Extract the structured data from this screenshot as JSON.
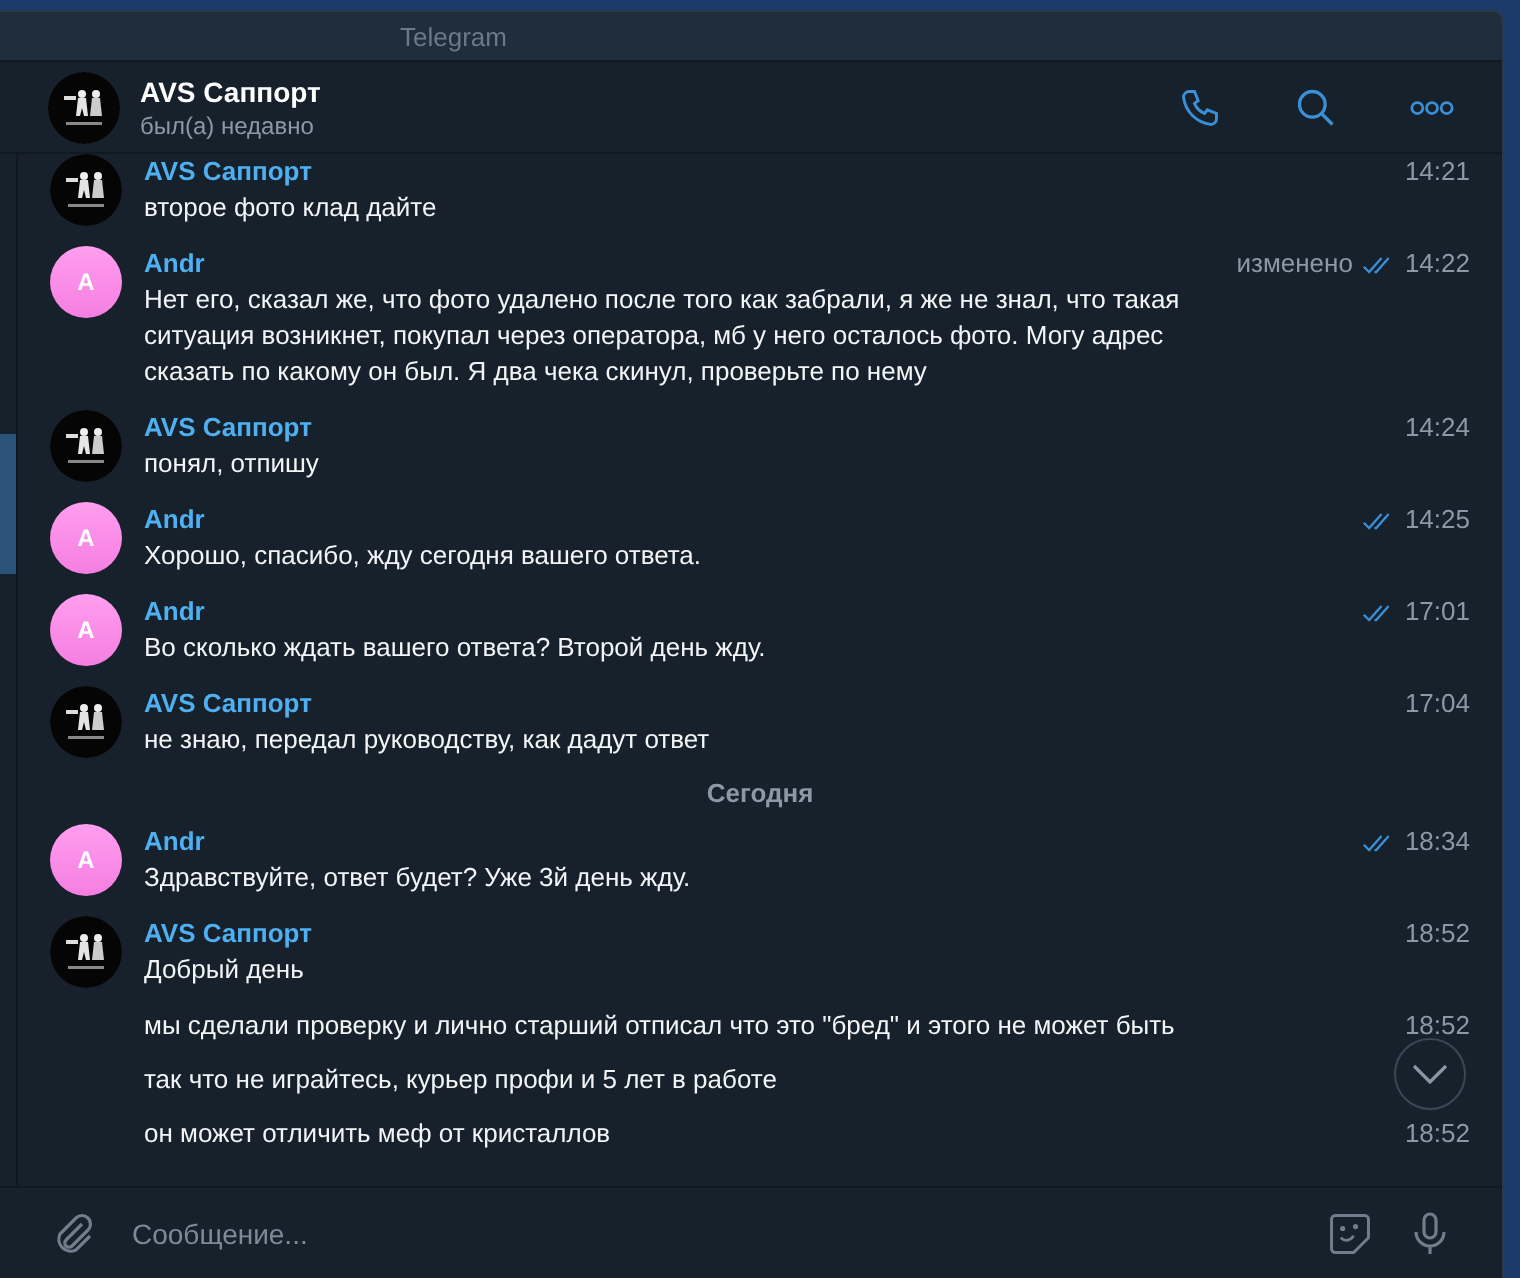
{
  "window": {
    "title": "Telegram"
  },
  "chat": {
    "name": "AVS Саппорт",
    "status": "был(а) недавно"
  },
  "messages": [
    {
      "kind": "message",
      "sender": "AVS Саппорт",
      "text": "второе фото клад дайте",
      "time": "14:21"
    },
    {
      "kind": "message",
      "sender": "Andr",
      "avatar": {
        "kind": "letter",
        "letter": "A"
      },
      "text": "Нет его, сказал же, что фото удалено после того как забрали, я же не знал, что такая ситуация возникнет, покупал через оператора, мб у него осталось фото. Могу адрес сказать по какому он был. Я два чека скинул, проверьте по нему",
      "time": "14:22",
      "edited": "изменено",
      "read": true
    },
    {
      "kind": "message",
      "sender": "AVS Саппорт",
      "text": "понял, отпишу",
      "time": "14:24"
    },
    {
      "kind": "message",
      "sender": "Andr",
      "avatar": {
        "kind": "letter",
        "letter": "A"
      },
      "text": "Хорошо, спасибо, жду сегодня вашего ответа.",
      "time": "14:25",
      "read": true
    },
    {
      "kind": "message",
      "sender": "Andr",
      "avatar": {
        "kind": "letter",
        "letter": "A"
      },
      "text": "Во сколько ждать вашего ответа? Второй день жду.",
      "time": "17:01",
      "read": true
    },
    {
      "kind": "message",
      "sender": "AVS Саппорт",
      "text": "не знаю, передал руководству, как дадут ответ",
      "time": "17:04"
    },
    {
      "kind": "date",
      "text": "Сегодня"
    },
    {
      "kind": "message",
      "sender": "Andr",
      "avatar": {
        "kind": "letter",
        "letter": "A"
      },
      "text": "Здравствуйте, ответ будет? Уже 3й день жду.",
      "time": "18:34",
      "read": true
    },
    {
      "kind": "message",
      "sender": "AVS Саппорт",
      "text": "Добрый день",
      "time": "18:52"
    },
    {
      "kind": "continuation",
      "text": "мы сделали проверку и лично старший отписал что это \"бред\" и этого не может быть",
      "time": "18:52"
    },
    {
      "kind": "continuation",
      "text": "так что не играйтесь, курьер профи и 5 лет в работе"
    },
    {
      "kind": "continuation",
      "text": "он может отличить меф от кристаллов",
      "time": "18:52"
    }
  ],
  "composer": {
    "placeholder": "Сообщение..."
  }
}
